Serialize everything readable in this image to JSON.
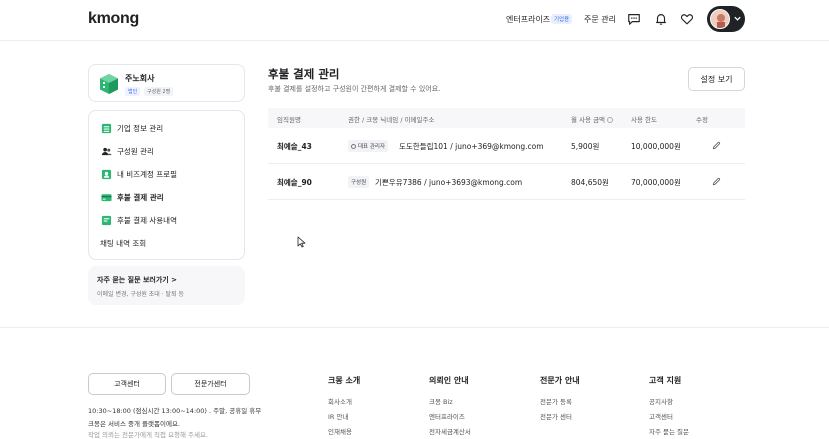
{
  "header": {
    "logo": "kmong",
    "nav_enterprise": "엔터프라이즈",
    "nav_enterprise_badge": "기업용",
    "nav_orders": "주문 관리"
  },
  "sidebar": {
    "company_name": "주노회사",
    "company_tag1": "법인",
    "company_tag2": "구성원 2명",
    "items": [
      {
        "label": "기업 정보 관리",
        "icon": "building-icon"
      },
      {
        "label": "구성원 관리",
        "icon": "members-icon"
      },
      {
        "label": "내 비즈계정 프로필",
        "icon": "profile-icon"
      },
      {
        "label": "후불 결제 관리",
        "icon": "card-icon",
        "active": true
      },
      {
        "label": "후불 결제 사용내역",
        "icon": "history-icon"
      },
      {
        "label": "채팅 내역 조회",
        "icon": ""
      }
    ],
    "faq_title": "자주 묻는 질문 보러가기 >",
    "faq_sub": "이메일 변경, 구성원 초대 · 탈퇴 등"
  },
  "main": {
    "title": "후불 결제 관리",
    "description": "후불 결제를 설정하고 구성원이 간편하게 결제할 수 있어요.",
    "settings_button": "설정 보기",
    "columns": [
      "임직원명",
      "권한 / 크몽 닉네임 / 이메일주소",
      "월 사용 금액",
      "사용 한도",
      "수정"
    ],
    "rows": [
      {
        "name": "최예슬_43",
        "role": "대표 관리자",
        "account": "도도한들립101 / juno+369@kmong.com",
        "monthly": "5,900원",
        "limit": "10,000,000원"
      },
      {
        "name": "최예슬_90",
        "role": "구성원",
        "account": "기쁜우유7386 / juno+3693@kmong.com",
        "monthly": "804,650원",
        "limit": "70,000,000원"
      }
    ]
  },
  "footer": {
    "btn_customer": "고객센터",
    "btn_expert": "전문가센터",
    "hours": "10:30~18:00 (점심시간 13:00~14:00) . 주말, 공휴일 휴무",
    "note": "크몽은 서비스 중개 플랫폼이에요.",
    "note2": "작업 의뢰는 전문가에게 직접 요청해 주세요.",
    "columns": [
      {
        "title": "크몽 소개",
        "links": [
          "회사소개",
          "IR 안내",
          "인재채용"
        ]
      },
      {
        "title": "의뢰인 안내",
        "links": [
          "크몽 Biz",
          "엔터프라이즈",
          "전자세금계산서"
        ]
      },
      {
        "title": "전문가 안내",
        "links": [
          "전문가 등록",
          "전문가 센터"
        ]
      },
      {
        "title": "고객 지원",
        "links": [
          "공지사항",
          "고객센터",
          "자주 묻는 질문"
        ]
      }
    ]
  },
  "colors": {
    "accent_green": "#2bb673",
    "dark": "#1f2326"
  }
}
